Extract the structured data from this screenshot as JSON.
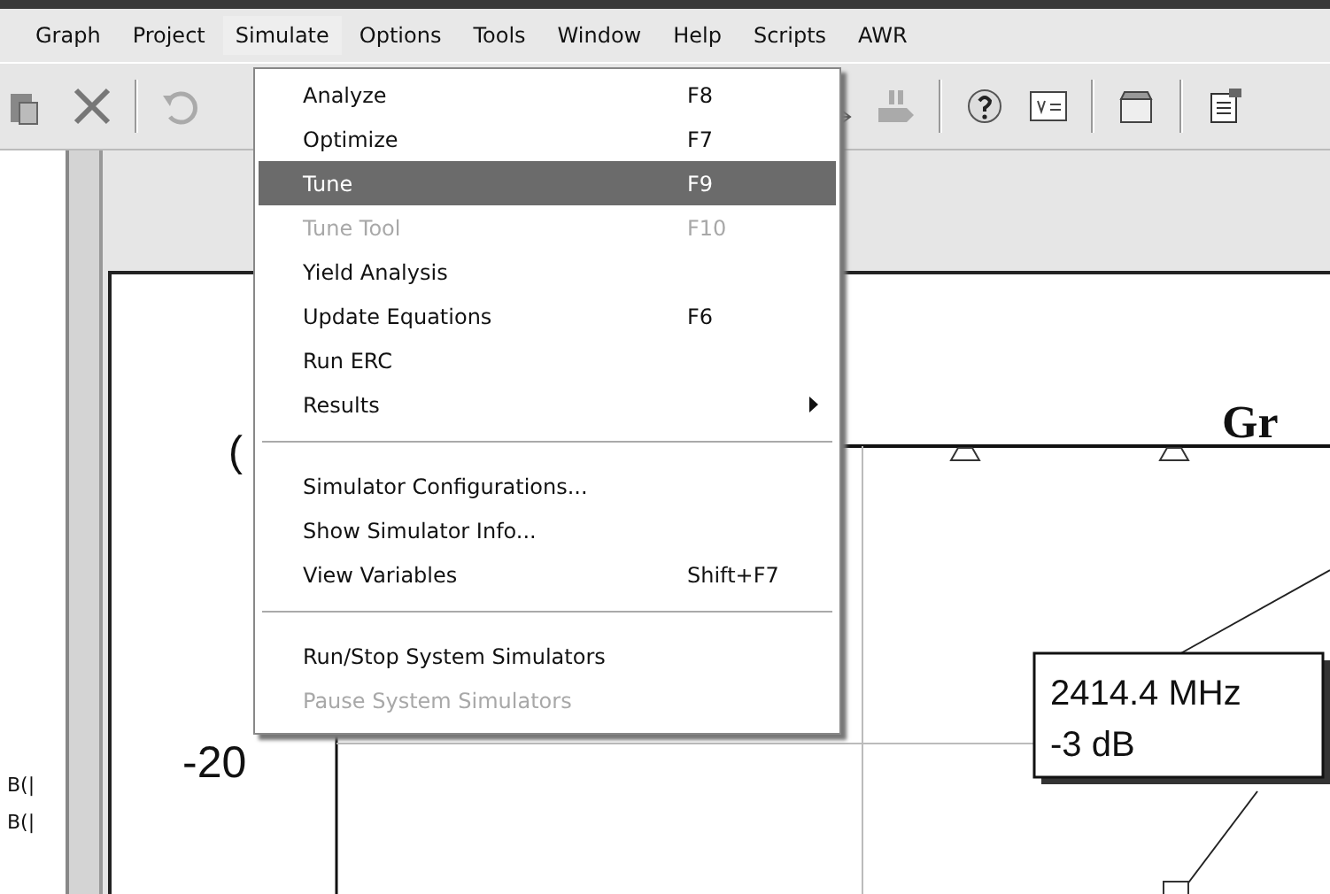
{
  "menu_bar": [
    {
      "label": "Graph",
      "selected": false
    },
    {
      "label": "Project",
      "selected": false
    },
    {
      "label": "Simulate",
      "selected": true
    },
    {
      "label": "Options",
      "selected": false
    },
    {
      "label": "Tools",
      "selected": false
    },
    {
      "label": "Window",
      "selected": false
    },
    {
      "label": "Help",
      "selected": false
    },
    {
      "label": "Scripts",
      "selected": false
    },
    {
      "label": "AWR",
      "selected": false
    }
  ],
  "simulate_menu": [
    {
      "kind": "item",
      "label": "Analyze",
      "shortcut": "F8",
      "selected": false,
      "disabled": false
    },
    {
      "kind": "item",
      "label": "Optimize",
      "shortcut": "F7",
      "selected": false,
      "disabled": false
    },
    {
      "kind": "item",
      "label": "Tune",
      "shortcut": "F9",
      "selected": true,
      "disabled": false
    },
    {
      "kind": "item",
      "label": "Tune Tool",
      "shortcut": "F10",
      "selected": false,
      "disabled": true
    },
    {
      "kind": "item",
      "label": "Yield Analysis",
      "selected": false,
      "disabled": false
    },
    {
      "kind": "item",
      "label": "Update Equations",
      "shortcut": "F6",
      "selected": false,
      "disabled": false
    },
    {
      "kind": "item",
      "label": "Run ERC",
      "selected": false,
      "disabled": false
    },
    {
      "kind": "submenu",
      "label": "Results",
      "selected": false,
      "disabled": false
    },
    {
      "kind": "separator"
    },
    {
      "kind": "item",
      "label": "Simulator Configurations...",
      "selected": false,
      "disabled": false
    },
    {
      "kind": "item",
      "label": "Show Simulator Info...",
      "selected": false,
      "disabled": false
    },
    {
      "kind": "item",
      "label": "View Variables",
      "shortcut": "Shift+F7",
      "selected": false,
      "disabled": false
    },
    {
      "kind": "separator"
    },
    {
      "kind": "item",
      "label": "Run/Stop System Simulators",
      "selected": false,
      "disabled": false
    },
    {
      "kind": "item",
      "label": "Pause System Simulators",
      "selected": false,
      "disabled": true
    }
  ],
  "left_panel": {
    "items": [
      "B(|",
      "B(|"
    ]
  },
  "graph": {
    "title": "Gr",
    "y_axis_label": "(",
    "y_tick": "-20",
    "marker": {
      "frequency": "2414.4 MHz",
      "value": "-3 dB"
    }
  }
}
